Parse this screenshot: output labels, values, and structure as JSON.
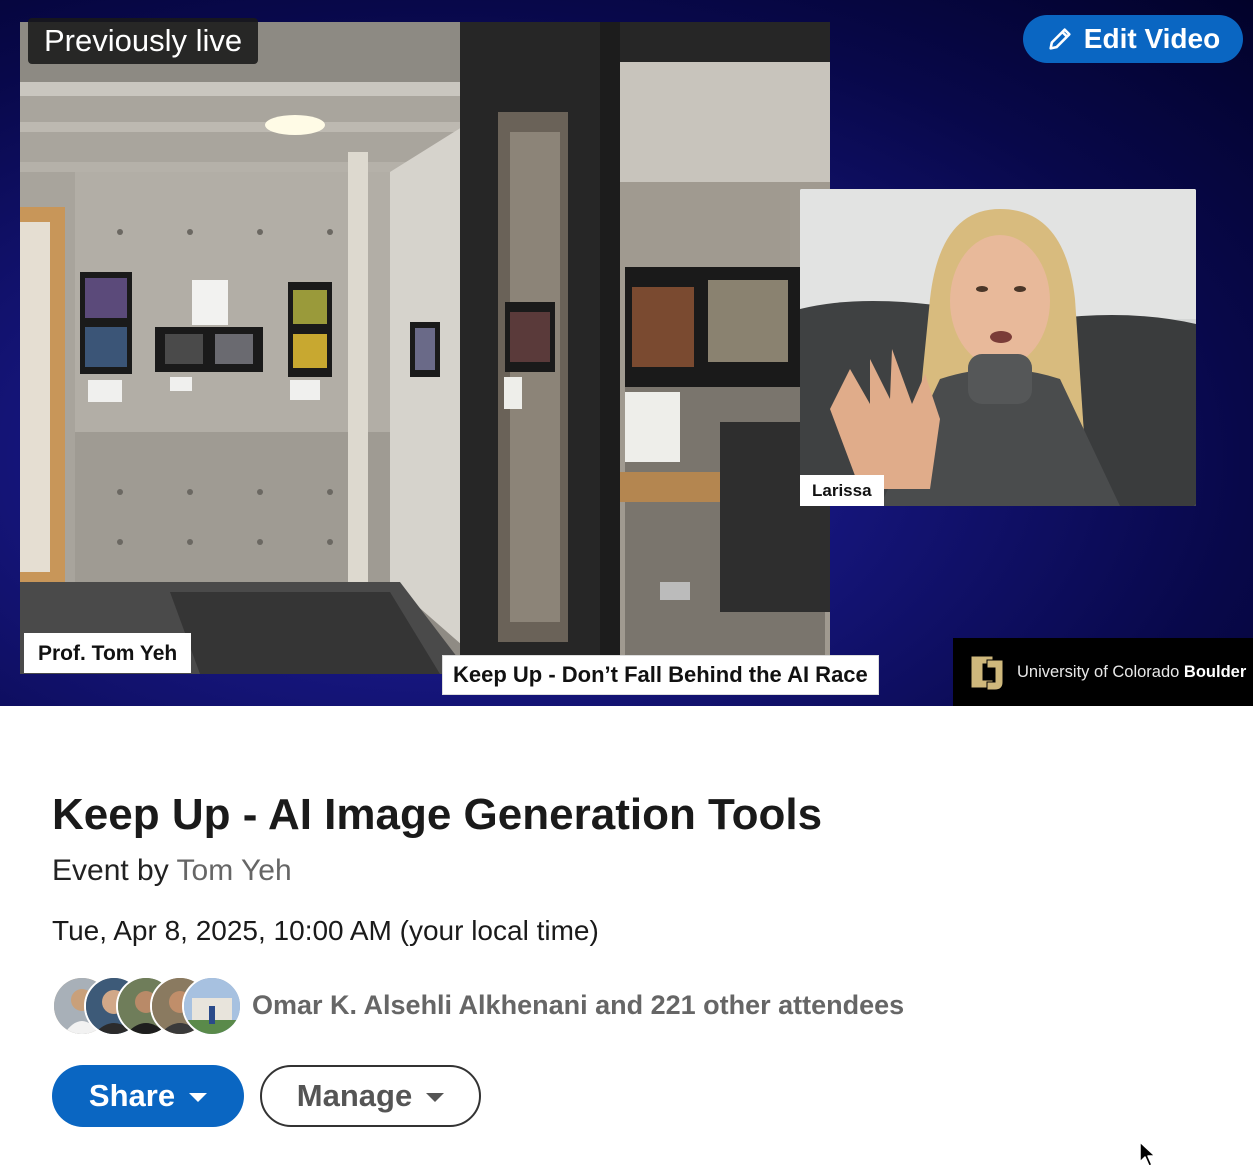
{
  "video": {
    "status_badge": "Previously live",
    "edit_label": "Edit Video",
    "speaker_main": "Prof. Tom Yeh",
    "speaker_pip": "Larissa",
    "session_title": "Keep Up - Don’t Fall Behind the AI Race",
    "branding": {
      "university": "University of Colorado",
      "campus": "Boulder"
    }
  },
  "event": {
    "title": "Keep Up - AI Image Generation Tools",
    "organizer_prefix": "Event by",
    "organizer_name": "Tom Yeh",
    "datetime": "Tue, Apr 8, 2025, 10:00 AM (your local time)",
    "attendees_text": "Omar K. Alsehli Alkhenani and 221 other attendees"
  },
  "actions": {
    "share_label": "Share",
    "manage_label": "Manage"
  },
  "colors": {
    "accent": "#0a66c2",
    "video_bg": "#0b0b5e"
  },
  "icons": [
    "pencil-icon",
    "caret-down-icon",
    "cu-logo-icon",
    "mouse-cursor-icon"
  ]
}
